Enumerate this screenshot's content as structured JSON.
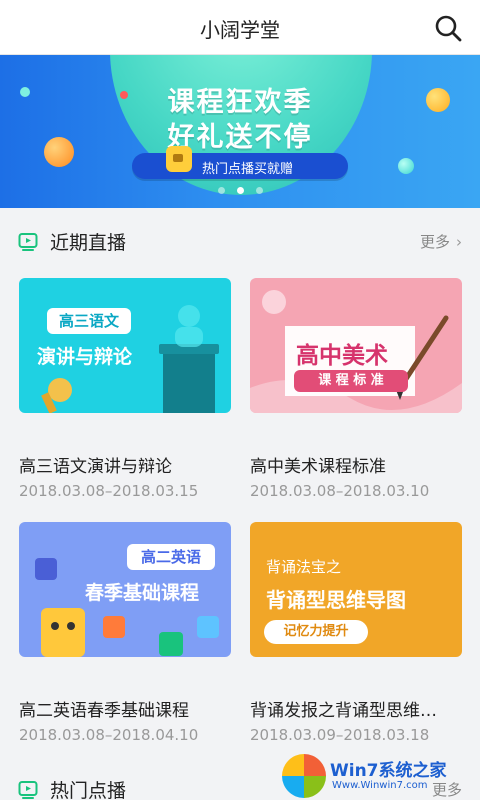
{
  "header": {
    "title": "小阔学堂",
    "search_icon": "search-icon"
  },
  "banner": {
    "headline_line1": "课程狂欢季",
    "headline_line2": "好礼送不停",
    "pill_text": "热门点播买就赠",
    "pill_icon": "camera-icon",
    "slide_count": 3,
    "active_slide": 2,
    "colors": {
      "background": "#2e8ff0",
      "arc": "#46d7c5",
      "pill": "#1a4fd1"
    }
  },
  "live_section": {
    "title": "近期直播",
    "more_label": "更多",
    "icon": "tv-icon",
    "accent": "#19c37d",
    "courses": [
      {
        "name": "高三语文演讲与辩论",
        "date": "2018.03.08–2018.03.15",
        "thumb_tag": "高三语文",
        "thumb_title": "演讲与辩论"
      },
      {
        "name": "高中美术课程标准",
        "date": "2018.03.08–2018.03.10",
        "thumb_title": "高中美术",
        "thumb_sub": "课 程 标 准"
      },
      {
        "name": "高二英语春季基础课程",
        "date": "2018.03.08–2018.04.10",
        "thumb_tag": "高二英语",
        "thumb_title": "春季基础课程"
      },
      {
        "name": "背诵发报之背诵型思维…",
        "date": "2018.03.09–2018.03.18",
        "thumb_small": "背诵法宝之",
        "thumb_title": "背诵型思维导图",
        "thumb_tag": "记忆力提升"
      }
    ]
  },
  "vod_section": {
    "title": "热门点播",
    "more_label": "更多",
    "icon": "tv-icon"
  },
  "watermark": {
    "text": "Win7系统之家",
    "sub": "Www.Winwin7.com"
  }
}
